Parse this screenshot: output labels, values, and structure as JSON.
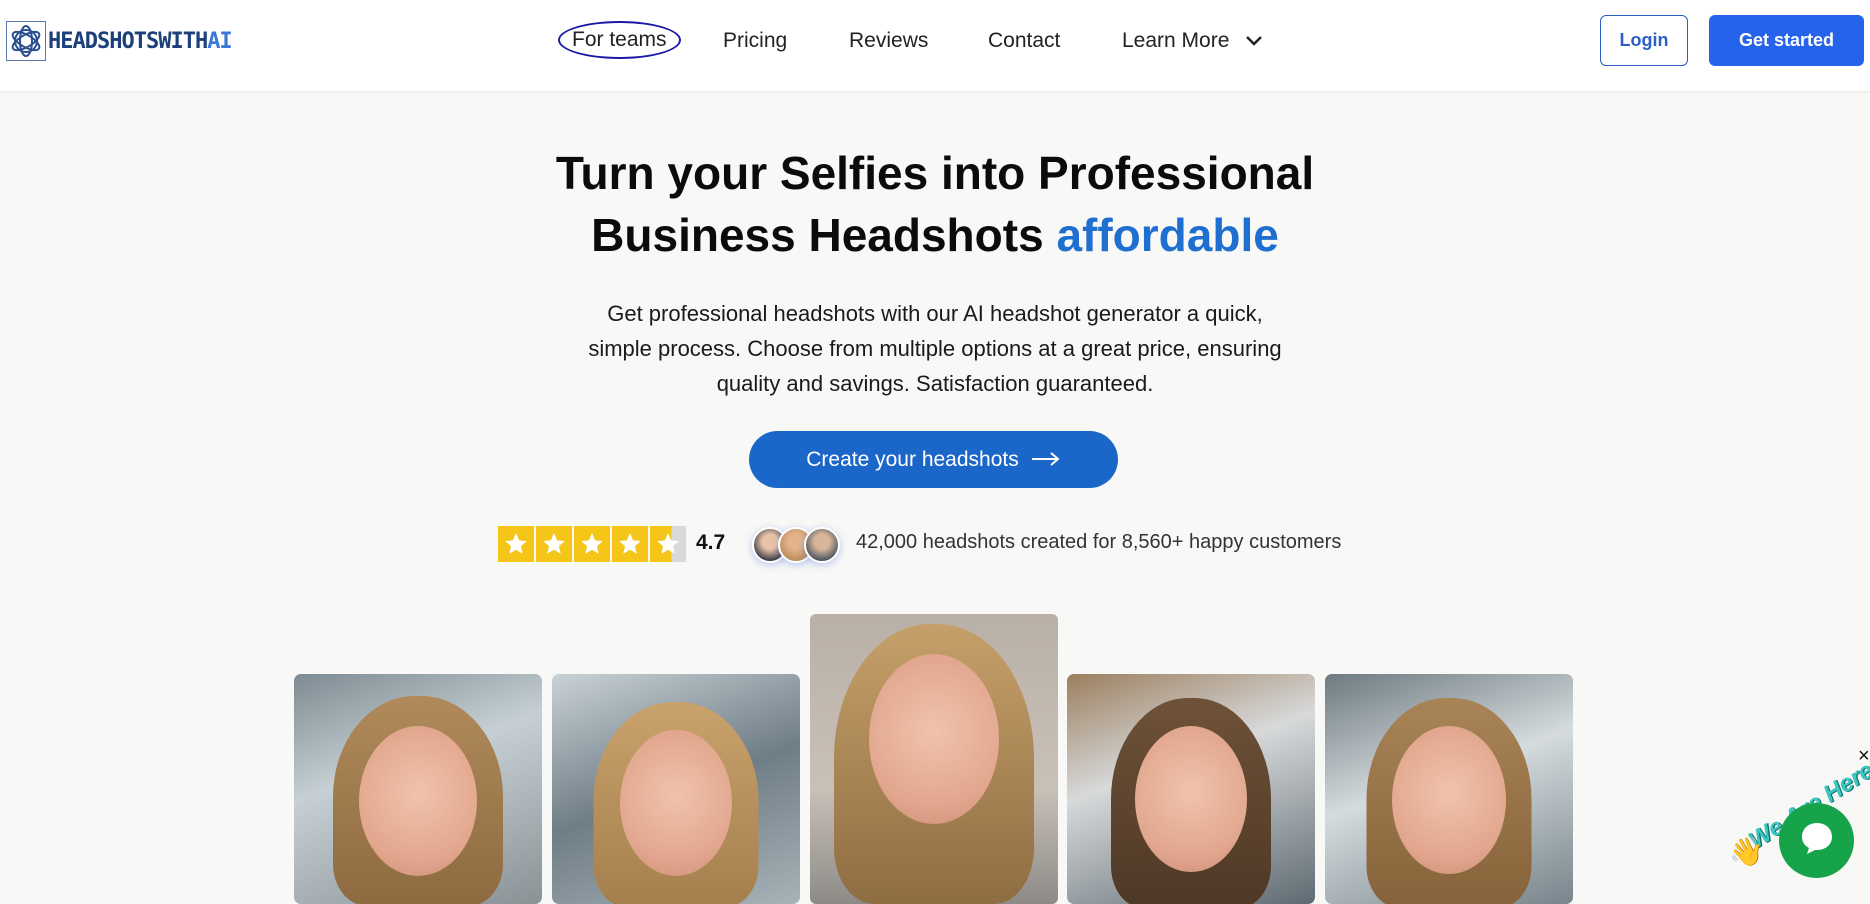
{
  "header": {
    "logo_text_main": "HEADSHOTSWITH",
    "logo_text_accent": "AI",
    "nav": [
      {
        "label": "For teams"
      },
      {
        "label": "Pricing"
      },
      {
        "label": "Reviews"
      },
      {
        "label": "Contact"
      },
      {
        "label": "Learn More"
      }
    ],
    "login_label": "Login",
    "get_started_label": "Get started"
  },
  "hero": {
    "title_line1": "Turn your Selfies into Professional",
    "title_line2_plain": "Business Headshots",
    "title_line2_accent": "affordable",
    "description": "Get professional headshots with our AI headshot generator a quick, simple process. Choose from multiple options at a great price, ensuring quality and savings. Satisfaction guaranteed.",
    "cta_label": "Create your headshots"
  },
  "rating": {
    "stars_value": 4.7,
    "stars_max": 5,
    "value_text": "4.7",
    "customers_text": "42,000 headshots created for 8,560+ happy customers"
  },
  "gallery": {
    "photo_count": 5
  },
  "chat_widget": {
    "label": "We Are Here!",
    "close_glyph": "×"
  },
  "colors": {
    "accent": "#1f6fd1",
    "primary_button": "#2563eb",
    "cta": "#1a66c9",
    "chat": "#16a34a",
    "star": "#f5c518"
  }
}
